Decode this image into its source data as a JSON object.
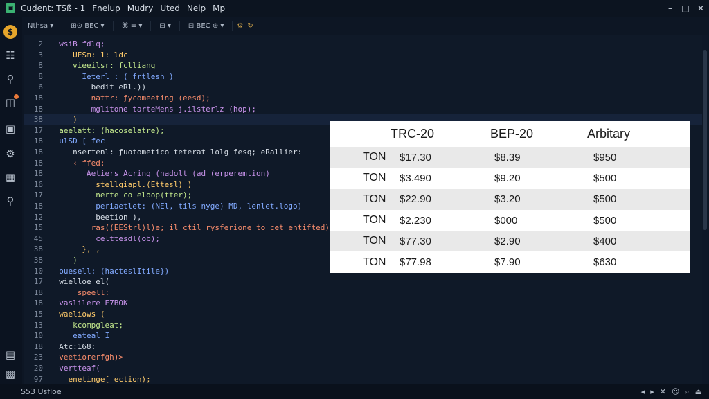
{
  "titlebar": {
    "title": "Cudent: TSß - 1",
    "menu": [
      "Fnelup",
      "Mudry",
      "Uted",
      "Nelp",
      "Mp"
    ],
    "controls": [
      "–",
      "□",
      "✕"
    ]
  },
  "toolbar": {
    "groups": [
      "Nthsa  ▾",
      "⊞⊙ BEC  ▾",
      "⌘ ≡ ▾",
      "⊟ ▾",
      "⊟ BEC ⊛  ▾"
    ],
    "icons": [
      "gear-icon",
      "refresh-icon"
    ]
  },
  "activity_bar": {
    "icons": [
      "logo-icon",
      "explorer-icon",
      "search-icon",
      "source-control-icon",
      "extensions-icon",
      "debug-icon",
      "testing-icon",
      "find-icon",
      "terminal-icon",
      "settings-icon"
    ]
  },
  "editor": {
    "lines": [
      {
        "n": "2",
        "t": "  wsiB fdlq;"
      },
      {
        "n": "3",
        "t": "     UESm: 1: ldc"
      },
      {
        "n": "8",
        "t": "     vieeilsr: fclliang"
      },
      {
        "n": "8",
        "t": "       Ieterl : ( frtlesh )"
      },
      {
        "n": "6",
        "t": "         bedit eRl.))"
      },
      {
        "n": "18",
        "t": "         nattr: ƒycomeeting (eesd);"
      },
      {
        "n": "18",
        "t": "         mglitone tarteMens j.ilsterlz (hop);"
      },
      {
        "n": "38",
        "t": "     )"
      },
      {
        "n": "17",
        "t": "  aeelatt: (hacoselatre);"
      },
      {
        "n": "18",
        "t": "  ulSD [ fec"
      },
      {
        "n": "18",
        "t": "     nsertenl: ƒuotometico teterat lolg fesq; eRallier:"
      },
      {
        "n": "18",
        "t": "     ‹ ffed:"
      },
      {
        "n": "18",
        "t": "        Aetiers Acring (nadolt (ad (erperemtion)"
      },
      {
        "n": "16",
        "t": "          stellgiapl.(Ettesl) )"
      },
      {
        "n": "17",
        "t": "          nerte co eloop(tter);"
      },
      {
        "n": "18",
        "t": "          periaetlet: (NEl, tils nyge) MD, lenlet.logo)"
      },
      {
        "n": "12",
        "t": "          beetion ),"
      },
      {
        "n": "15",
        "t": "         ras((EEStrl)l)e; il ctil rysferione to cet entifted)"
      },
      {
        "n": "45",
        "t": "          celttesdl(ob);"
      },
      {
        "n": "38",
        "t": "       }, ,"
      },
      {
        "n": "38",
        "t": "     )"
      },
      {
        "n": "10",
        "t": "  ouesell: (hacteslItile})"
      },
      {
        "n": "17",
        "t": "  wielloe el("
      },
      {
        "n": "18",
        "t": "      speell:"
      },
      {
        "n": "18",
        "t": "  vaslilere E7BOK"
      },
      {
        "n": "15",
        "t": "  waeliows ("
      },
      {
        "n": "13",
        "t": "     kcompgleat;"
      },
      {
        "n": "10",
        "t": "     eateal I"
      },
      {
        "n": "18",
        "t": "  Atc:168:"
      },
      {
        "n": "23",
        "t": "  veetiorerfgh)>"
      },
      {
        "n": "20",
        "t": "  vertteaf("
      },
      {
        "n": "97",
        "t": "    enetinge[ ection);"
      }
    ]
  },
  "table": {
    "headers": [
      "",
      "TRC-20",
      "BEP-20",
      "Arbitary"
    ],
    "rows": [
      [
        "TON",
        "$17.30",
        "$8.39",
        "$950"
      ],
      [
        "TON",
        "$3.490",
        "$9.20",
        "$500"
      ],
      [
        "TON",
        "$22.90",
        "$3.20",
        "$500"
      ],
      [
        "TON",
        "$2.230",
        "$000",
        "$500"
      ],
      [
        "TON",
        "$77.30",
        "$2.90",
        "$400"
      ],
      [
        "TON",
        "$77.98",
        "$7.90",
        "$630"
      ]
    ]
  },
  "statusbar": {
    "left": "S53 Usfloe",
    "right_icons": [
      "◂",
      "▸",
      "✕",
      "☺",
      "⌕",
      "⏏"
    ]
  }
}
